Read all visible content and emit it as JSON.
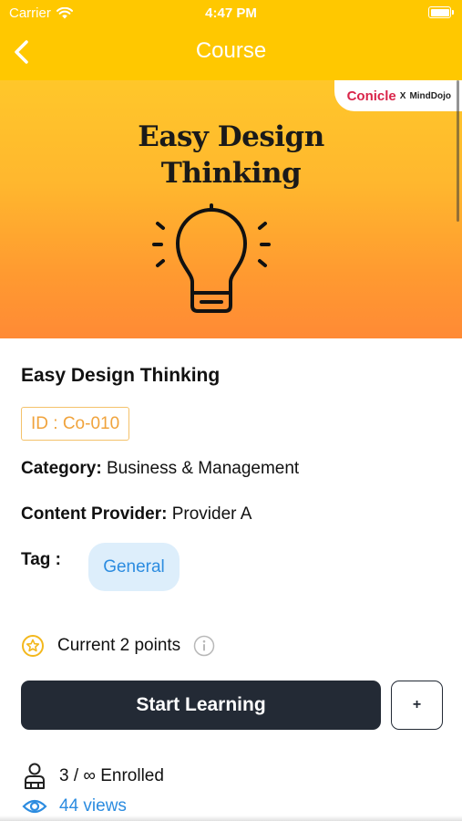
{
  "status_bar": {
    "carrier": "Carrier",
    "time": "4:47 PM"
  },
  "nav": {
    "title": "Course",
    "back_icon": "chevron-left-icon"
  },
  "banner": {
    "title_line1": "Easy Design",
    "title_line2": "Thinking",
    "icon": "lightbulb-icon",
    "brand_left": "Conicle",
    "brand_x": "X",
    "brand_right": "MindDojo"
  },
  "course": {
    "title": "Easy Design Thinking",
    "id_badge": "ID : Co-010",
    "category_label": "Category:",
    "category_value": "Business & Management",
    "provider_label": "Content Provider:",
    "provider_value": "Provider A",
    "tag_label": "Tag :",
    "tags": [
      "General"
    ]
  },
  "points": {
    "text": "Current 2 points",
    "icon": "star-badge-icon",
    "info_icon": "info-icon"
  },
  "actions": {
    "start_label": "Start Learning",
    "add_label": "+"
  },
  "stats": {
    "enrolled_text": "3 / ∞  Enrolled",
    "enrolled_icon": "user-icon",
    "views_text": "44 views",
    "views_icon": "eye-icon"
  },
  "colors": {
    "header": "#FFC800",
    "button_dark": "#232A35",
    "accent_blue": "#2C8CE0",
    "badge_orange": "#F0A33C",
    "chip_bg": "#DDEEFB"
  }
}
